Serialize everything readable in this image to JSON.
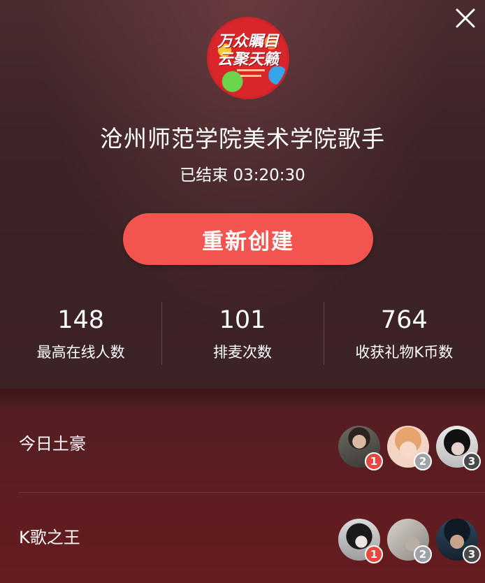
{
  "header": {
    "close_icon": "close-icon",
    "room_avatar_text_line1": "万众瞩目",
    "room_avatar_text_line2": "云聚天籁"
  },
  "room": {
    "title": "沧州师范学院美术学院歌手",
    "status": "已结束 03:20:30"
  },
  "actions": {
    "recreate_label": "重新创建"
  },
  "stats": [
    {
      "value": "148",
      "label": "最高在线人数"
    },
    {
      "value": "101",
      "label": "排麦次数"
    },
    {
      "value": "764",
      "label": "收获礼物K币数"
    }
  ],
  "rankings": [
    {
      "label": "今日土豪",
      "ranks": [
        "1",
        "2",
        "3"
      ]
    },
    {
      "label": "K歌之王",
      "ranks": [
        "1",
        "2",
        "3"
      ]
    }
  ],
  "colors": {
    "accent": "#f2554f",
    "background_top": "#3c2427",
    "background_bottom": "#5e1d21"
  }
}
